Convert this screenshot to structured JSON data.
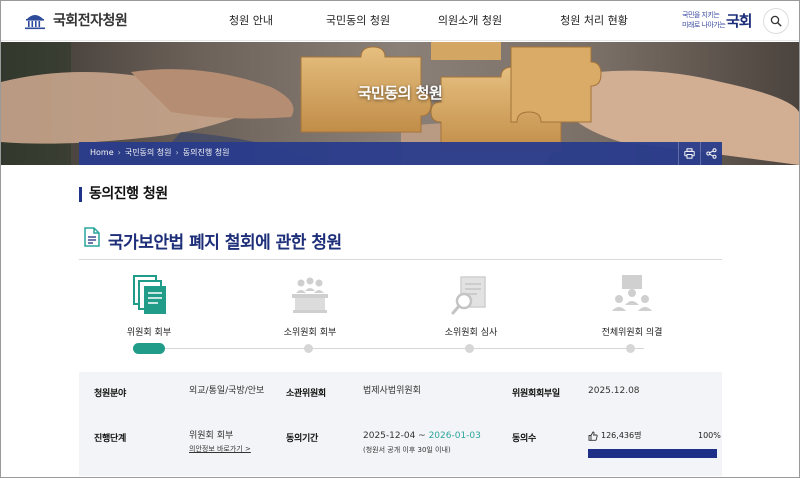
{
  "header": {
    "logo_text": "국회전자청원",
    "nav": [
      "청원 안내",
      "국민동의 청원",
      "의원소개 청원",
      "청원 처리 현황"
    ],
    "slogan_line1": "국민을 지키는",
    "slogan_line2": "미래로 나아가는",
    "slogan_mark": "국회"
  },
  "banner": {
    "title": "국민동의 청원"
  },
  "breadcrumb": [
    "Home",
    "국민동의 청원",
    "동의진행 청원"
  ],
  "section_title": "동의진행 청원",
  "petition": {
    "title": "국가보안법 폐지 철회에 관한 청원"
  },
  "steps": [
    {
      "label": "위원회 회부",
      "active": true,
      "icon": "documents-icon"
    },
    {
      "label": "소위원회 회부",
      "active": false,
      "icon": "meeting-icon"
    },
    {
      "label": "소위원회 심사",
      "active": false,
      "icon": "review-icon"
    },
    {
      "label": "전체위원회 의결",
      "active": false,
      "icon": "vote-icon"
    }
  ],
  "info": {
    "field_label": "청원분야",
    "field_value": "외교/통일/국방/안보",
    "committee_label": "소관위원회",
    "committee_value": "법제사법위원회",
    "referral_date_label": "위원회회부일",
    "referral_date_value": "2025.12.08",
    "stage_label": "진행단계",
    "stage_value": "위원회 회부",
    "stage_link": "의안정보 바로가기 >",
    "period_label": "동의기간",
    "period_start": "2025-12-04",
    "period_sep": " ~ ",
    "period_end": "2026-01-03",
    "period_note": "(청원서 공개 이후 30일 이내)",
    "agree_label": "동의수",
    "agree_count": "126,436명",
    "agree_percent": "100%",
    "agree_fraction": 1.0
  },
  "colors": {
    "navy": "#1f3488",
    "teal": "#219c89",
    "bar_fill": "#1d2f86"
  }
}
